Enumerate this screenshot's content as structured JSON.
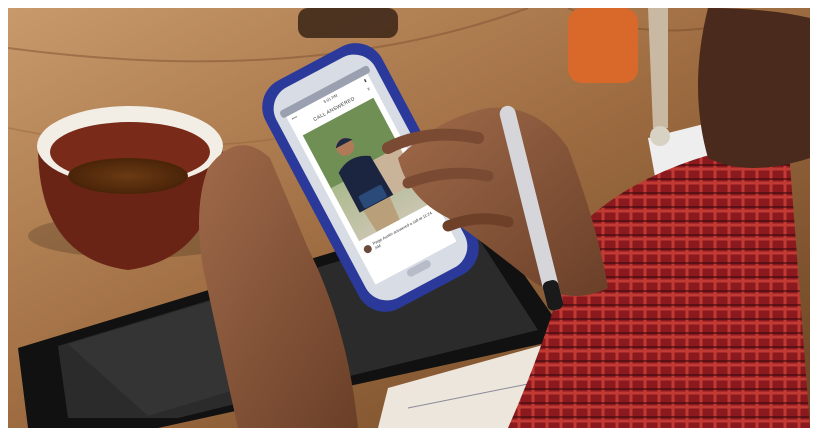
{
  "phone": {
    "status_time": "5:01 PM",
    "header_title": "CALL ANSWERED",
    "close_glyph": "×",
    "caption": "Paige Austin answered a call at 11:24 AM"
  },
  "icons": {
    "close": "close-icon",
    "avatar": "avatar"
  },
  "colors": {
    "phone_case_blue": "#2b3a9a",
    "tea_cup": "#6a2415",
    "shirt_red": "#8a1a1e"
  }
}
